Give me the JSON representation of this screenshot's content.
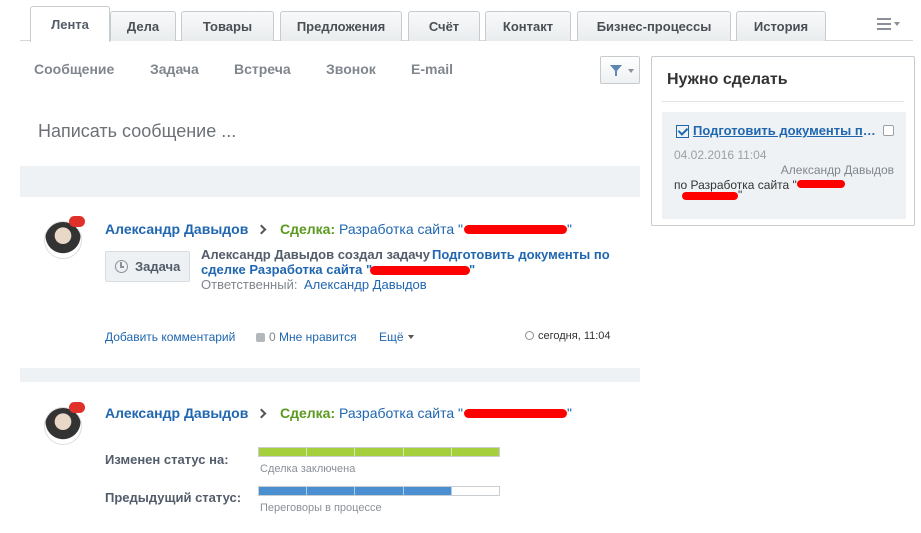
{
  "tabs": [
    {
      "label": "Лента",
      "active": true
    },
    {
      "label": "Дела"
    },
    {
      "label": "Товары"
    },
    {
      "label": "Предложения"
    },
    {
      "label": "Счёт"
    },
    {
      "label": "Контакт"
    },
    {
      "label": "Бизнес-процессы"
    },
    {
      "label": "История"
    }
  ],
  "post_types": [
    "Сообщение",
    "Задача",
    "Встреча",
    "Звонок",
    "E-mail"
  ],
  "compose_placeholder": "Написать сообщение ...",
  "feed": {
    "item1": {
      "author": "Александр Давыдов",
      "deal_label": "Сделка:",
      "deal_name": "Разработка сайта \"",
      "deal_close": "\"",
      "task_badge": "Задача",
      "text_prefix": "Александр Давыдов создал задачу",
      "task_link_1": "Подготовить документы по",
      "task_link_2": "сделке Разработка сайта \"",
      "task_link_close": "\"",
      "responsible_label": "Ответственный:",
      "responsible_name": "Александр Давыдов",
      "add_comment": "Добавить комментарий",
      "like_count": "0",
      "like_label": "Мне нравится",
      "more_label": "Ещё",
      "time": "сегодня, 11:04"
    },
    "item2": {
      "author": "Александр Давыдов",
      "deal_label": "Сделка:",
      "deal_name": "Разработка сайта \"",
      "deal_close": "\"",
      "new_status_label": "Изменен статус на:",
      "new_status_caption": "Сделка заключена",
      "new_status_progress": 1.0,
      "new_status_color": "#a6cf3d",
      "prev_status_label": "Предыдущий статус:",
      "prev_status_caption": "Переговоры в процессе",
      "prev_status_progress": 0.8,
      "prev_status_color": "#4a90d0"
    }
  },
  "todo": {
    "title": "Нужно сделать",
    "task_link": "Подготовить документы по сделке Разработка сайта",
    "date": "04.02.2016 11:04",
    "responsible": "Александр Давыдов",
    "deal_prefix": "по Разработка сайта \"",
    "deal_close": "\""
  }
}
